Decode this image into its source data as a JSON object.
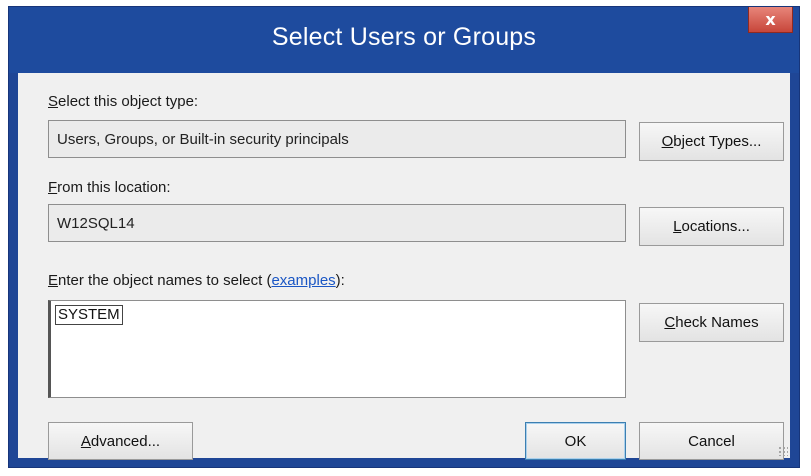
{
  "window": {
    "title": "Select Users or Groups",
    "close_label": "x"
  },
  "object_type": {
    "label_prefix": "S",
    "label_rest": "elect this object type:",
    "value": "Users, Groups, or Built-in security principals",
    "button_u": "O",
    "button_rest": "bject Types..."
  },
  "location": {
    "label_prefix": "F",
    "label_rest": "rom this location:",
    "value": "W12SQL14",
    "button_u": "L",
    "button_rest": "ocations..."
  },
  "names": {
    "label_prefix": "E",
    "label_rest": "nter the object names to select (",
    "link": "examples",
    "label_end": "):",
    "value": "SYSTEM",
    "check_u": "C",
    "check_rest": "heck Names"
  },
  "footer": {
    "advanced_u": "A",
    "advanced_rest": "dvanced...",
    "ok_label": "OK",
    "cancel_label": "Cancel"
  },
  "colors": {
    "title_bar": "#1e4b9e",
    "close_button": "#c7463a",
    "client_bg": "#f0f0f0",
    "link": "#1a56c4"
  }
}
